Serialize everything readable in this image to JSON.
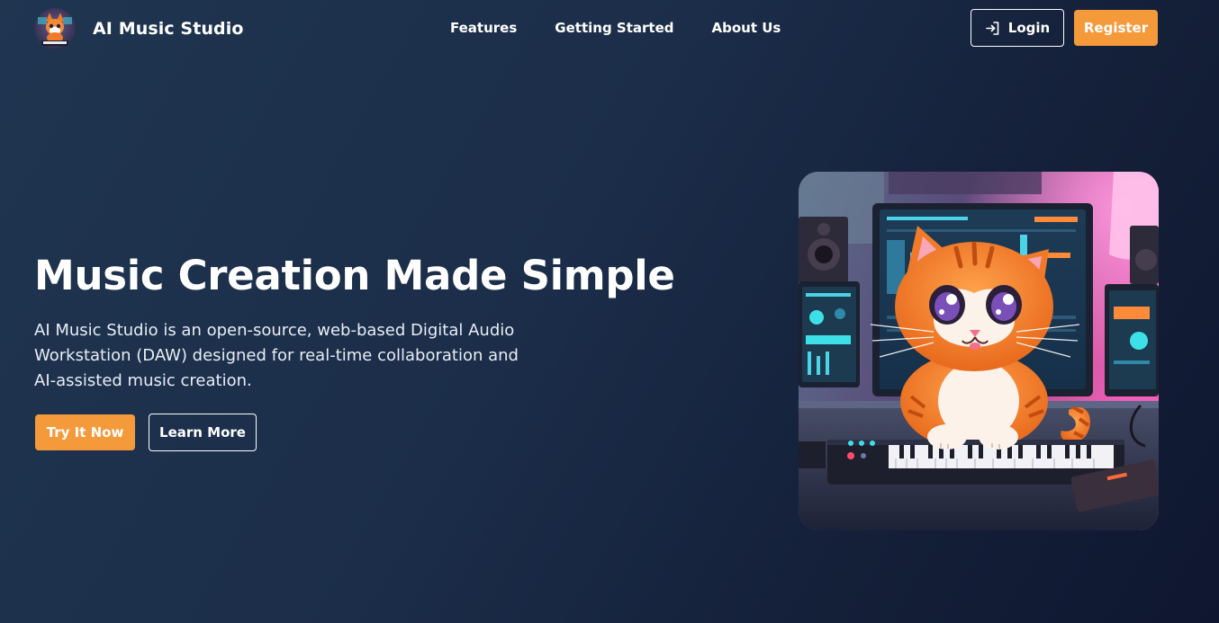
{
  "brand": {
    "name": "AI Music Studio",
    "logo_icon": "cat-logo-icon"
  },
  "nav": {
    "links": [
      {
        "label": "Features"
      },
      {
        "label": "Getting Started"
      },
      {
        "label": "About Us"
      }
    ],
    "login_label": "Login",
    "login_icon": "sign-in-icon",
    "register_label": "Register"
  },
  "hero": {
    "title": "Music Creation Made Simple",
    "description": "AI Music Studio is an open-source, web-based Digital Audio Workstation (DAW) designed for real-time collaboration and AI-assisted music creation.",
    "primary_button": "Try It Now",
    "secondary_button": "Learn More",
    "image_subject": "cartoon cat playing keyboard in music studio"
  },
  "colors": {
    "background": "#1b2d49",
    "accent": "#f59a3b",
    "text": "#ffffff"
  }
}
